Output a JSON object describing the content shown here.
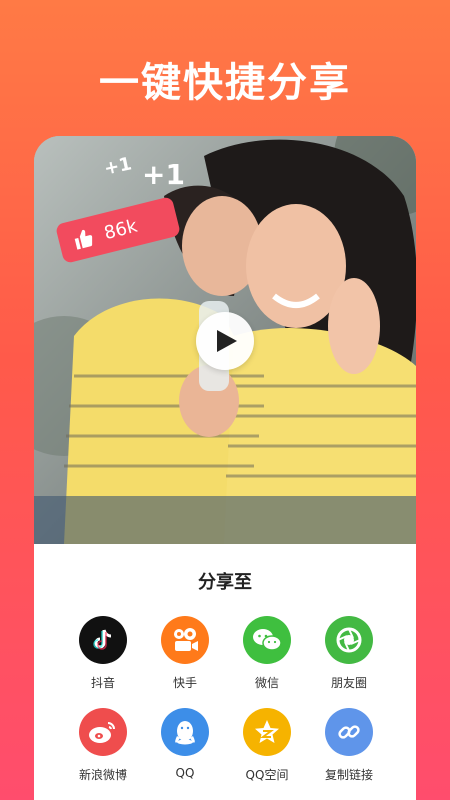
{
  "headline": "一键快捷分享",
  "hero": {
    "plus_small": "+1",
    "plus_large": "+1",
    "like_count": "86k"
  },
  "share": {
    "title": "分享至",
    "targets": [
      {
        "label": "抖音",
        "icon": "douyin-icon",
        "color": "#111111"
      },
      {
        "label": "快手",
        "icon": "kuaishou-icon",
        "color": "#ff7a1a"
      },
      {
        "label": "微信",
        "icon": "wechat-icon",
        "color": "#3fbf3f"
      },
      {
        "label": "朋友圈",
        "icon": "moments-icon",
        "color": "#43b943"
      },
      {
        "label": "新浪微博",
        "icon": "weibo-icon",
        "color": "#ef4d4d"
      },
      {
        "label": "QQ",
        "icon": "qq-icon",
        "color": "#3d8ee8"
      },
      {
        "label": "QQ空间",
        "icon": "qzone-icon",
        "color": "#f6b300"
      },
      {
        "label": "复制链接",
        "icon": "link-icon",
        "color": "#5f95ea"
      }
    ]
  }
}
